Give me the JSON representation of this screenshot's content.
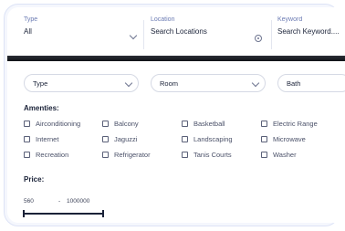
{
  "search": {
    "type": {
      "label": "Type",
      "value": "All"
    },
    "location": {
      "label": "Location",
      "value": "Search Locations"
    },
    "keyword": {
      "label": "Keyword",
      "value": "Search Keyword...."
    }
  },
  "filters": {
    "selects": [
      {
        "value": "Type"
      },
      {
        "value": "Room"
      },
      {
        "value": "Bath"
      }
    ]
  },
  "amenities": {
    "title": "Amenties:",
    "items": [
      "Airconditioning",
      "Balcony",
      "Basketball",
      "Electric Range",
      "Internet",
      "Jaguzzi",
      "Landscaping",
      "Microwave",
      "Recreation",
      "Refrigerator",
      "Tanis Courts",
      "Washer"
    ]
  },
  "price": {
    "title": "Price:",
    "min": "560",
    "separator": "-",
    "max": "1000000"
  },
  "icons": {
    "chevron": "chevron-down-icon",
    "location": "crosshair-icon"
  }
}
